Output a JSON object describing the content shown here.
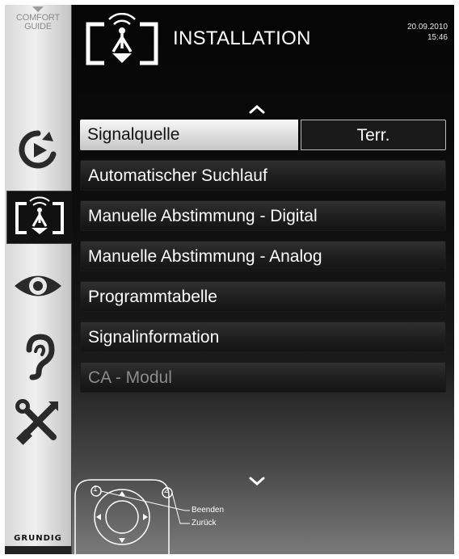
{
  "sidebar": {
    "comfort_guide": [
      "COMFORT",
      "GUIDE"
    ],
    "items": [
      {
        "icon": "source-icon",
        "active": false
      },
      {
        "icon": "installation-antenna-icon",
        "active": true
      },
      {
        "icon": "eye-icon",
        "active": false
      },
      {
        "icon": "ear-icon",
        "active": false
      },
      {
        "icon": "tools-icon",
        "active": false
      }
    ],
    "brand": "GRUNDIG"
  },
  "header": {
    "title": "INSTALLATION",
    "date": "20.09.2010",
    "time": "15:46"
  },
  "menu": {
    "items": [
      {
        "label": "Signalquelle",
        "value": "Terr.",
        "selected": true,
        "enabled": true
      },
      {
        "label": "Automatischer Suchlauf",
        "enabled": true
      },
      {
        "label": "Manuelle Abstimmung - Digital",
        "enabled": true
      },
      {
        "label": "Manuelle Abstimmung - Analog",
        "enabled": true
      },
      {
        "label": "Programmtabelle",
        "enabled": true
      },
      {
        "label": "Signalinformation",
        "enabled": true
      },
      {
        "label": "CA - Modul",
        "enabled": false
      }
    ]
  },
  "help": {
    "exit_key": "1",
    "back_key": "2",
    "exit_label": "Beenden",
    "back_label": "Zurück"
  },
  "colors": {
    "background": "#0c0c0c",
    "selected_row": "#dcdcdc",
    "sidebar": "#e4e4e4",
    "disabled_text": "#8c8c8c"
  }
}
